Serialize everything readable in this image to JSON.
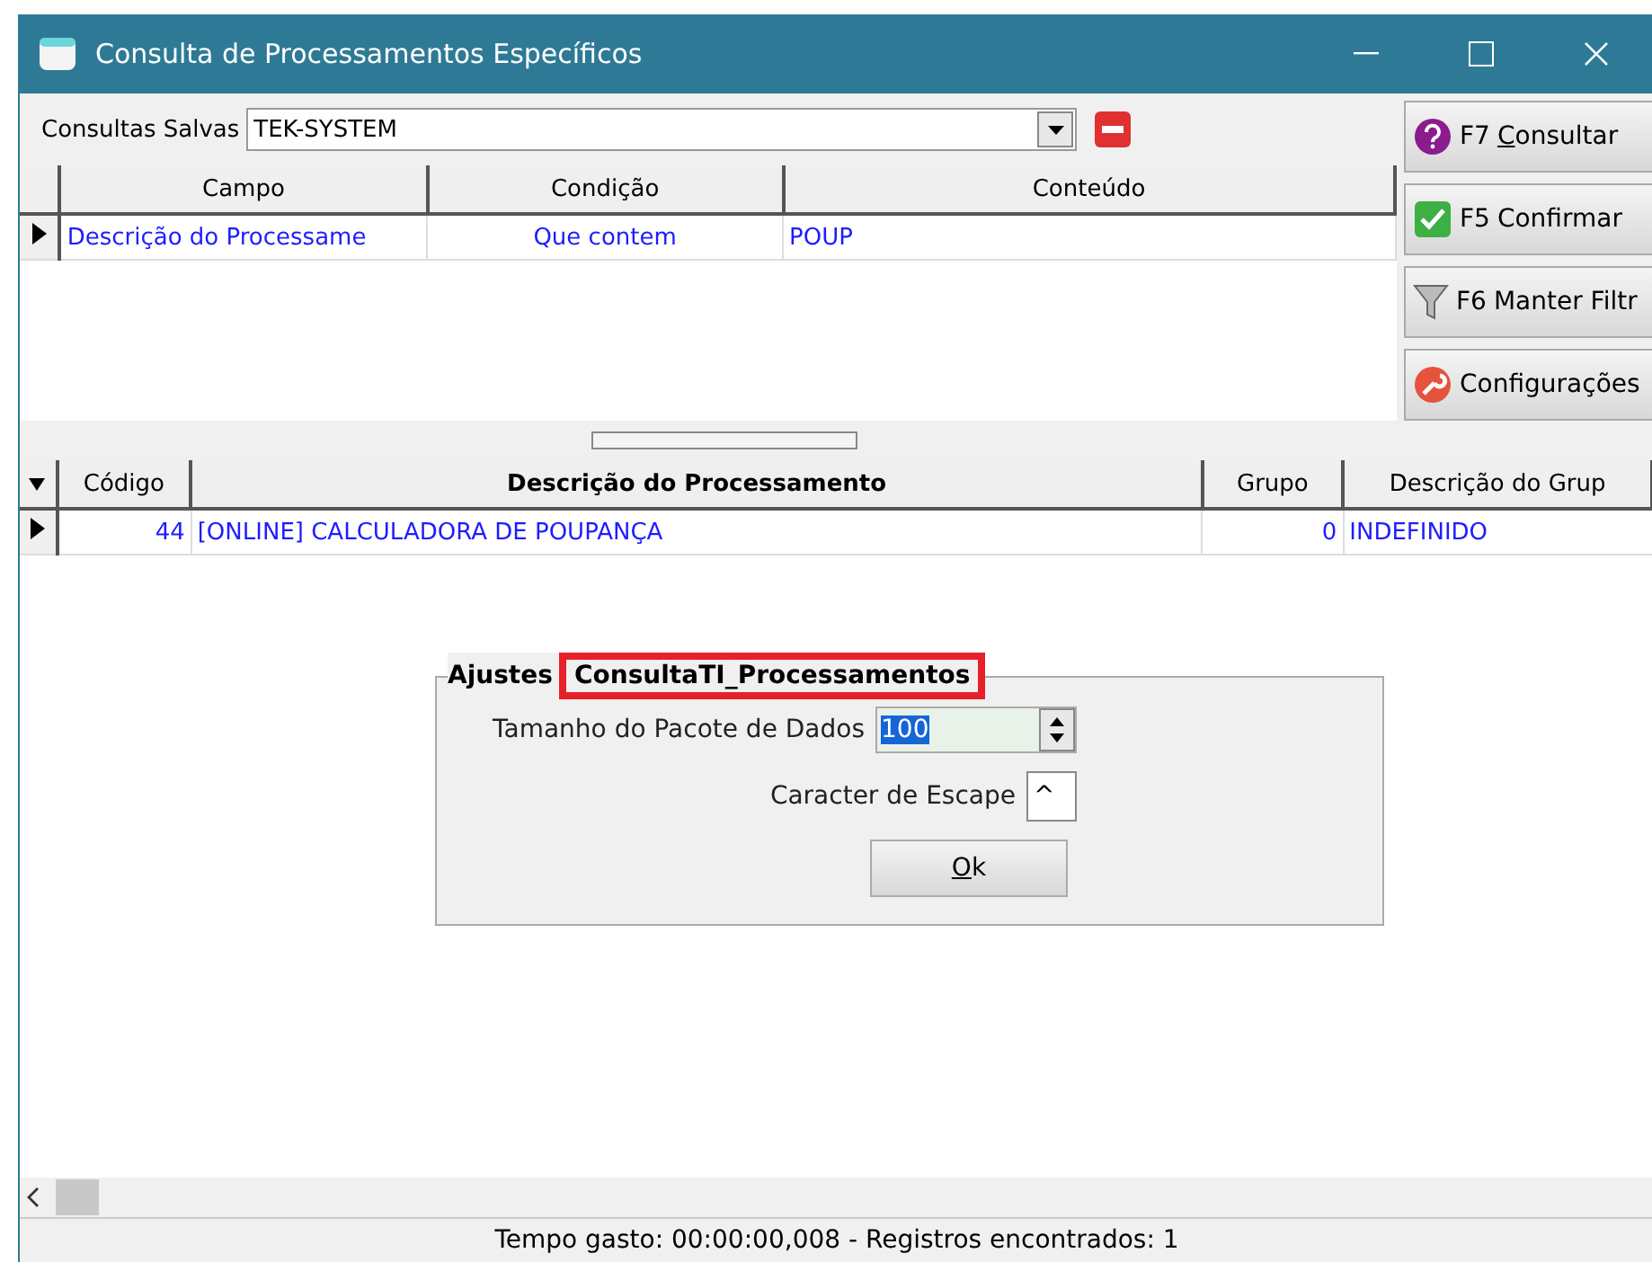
{
  "window": {
    "title": "Consulta de Processamentos Específicos"
  },
  "saved_queries": {
    "label": "Consultas Salvas",
    "value": "TEK-SYSTEM"
  },
  "filter_grid": {
    "columns": [
      "Campo",
      "Condição",
      "Conteúdo"
    ],
    "rows": [
      {
        "selected": true,
        "cells": [
          "Descrição do Processame",
          "Que contem",
          "POUP"
        ]
      }
    ]
  },
  "actions": [
    {
      "kind": "help",
      "key": "F7",
      "label": "Consultar"
    },
    {
      "kind": "check",
      "key": "F5",
      "label": "Confirmar"
    },
    {
      "kind": "filter",
      "key": "F6",
      "label": "Manter Filtr"
    },
    {
      "kind": "wrench",
      "label": "Configurações"
    }
  ],
  "results_grid": {
    "columns": [
      "Código",
      "Descrição do Processamento",
      "Grupo",
      "Descrição do Grup"
    ],
    "rows": [
      {
        "selected": true,
        "cells": [
          "44",
          "[ONLINE] CALCULADORA DE POUPANÇA",
          "0",
          "INDEFINIDO"
        ]
      }
    ]
  },
  "settings_dialog": {
    "caption": "Ajustes",
    "name": "ConsultaTI_Processamentos",
    "packet_label": "Tamanho do Pacote de Dados",
    "packet_value": "100",
    "escape_label": "Caracter de Escape",
    "escape_value": "^",
    "ok": "Ok"
  },
  "status_bar": {
    "text": "Tempo gasto: 00:00:00,008  -  Registros encontrados: 1"
  }
}
